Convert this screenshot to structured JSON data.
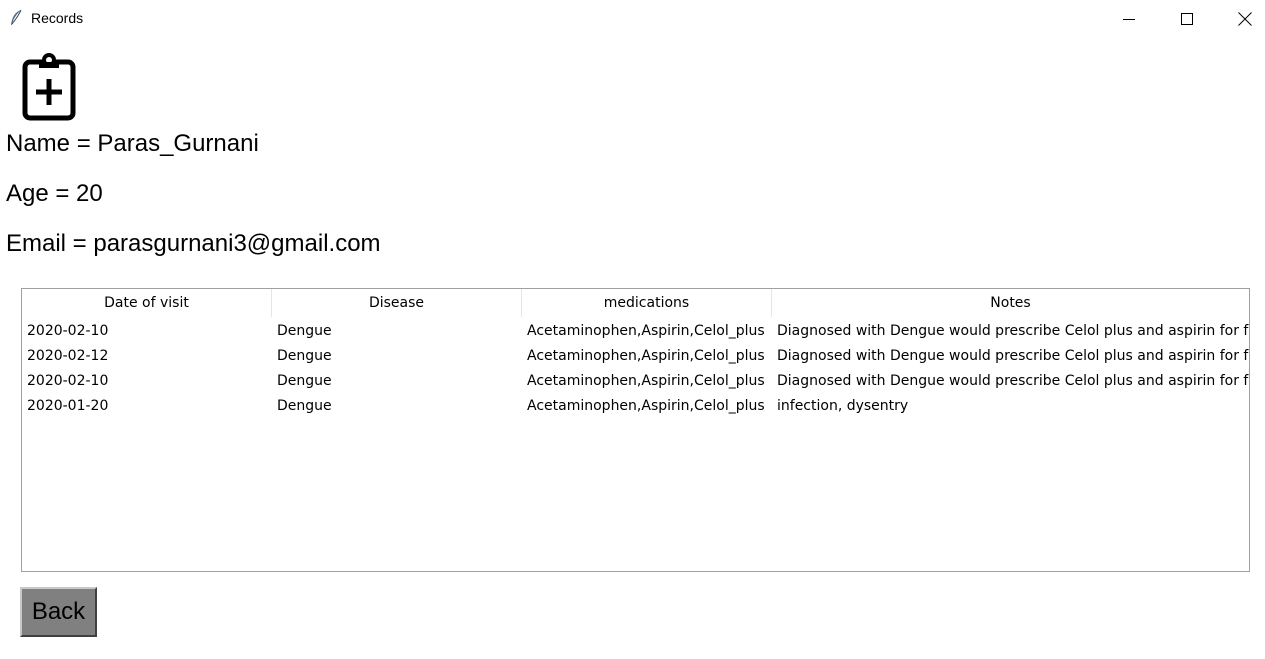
{
  "window": {
    "title": "Records",
    "icons": {
      "app": "feather-icon",
      "minimize": "minimize-icon",
      "maximize": "maximize-icon",
      "close": "close-icon"
    }
  },
  "patient": {
    "icon": "clipboard-plus-icon",
    "name_line": "Name = Paras_Gurnani",
    "age_line": "Age = 20",
    "email_line": "Email = parasgurnani3@gmail.com"
  },
  "records_table": {
    "columns": [
      "Date of visit",
      "Disease",
      "medications",
      "Notes"
    ],
    "rows": [
      [
        "2020-02-10",
        "Dengue",
        "Acetaminophen,Aspirin,Celol_plus",
        "Diagnosed with Dengue would prescribe Celol plus and aspirin for feve"
      ],
      [
        "2020-02-12",
        "Dengue",
        "Acetaminophen,Aspirin,Celol_plus",
        "Diagnosed with Dengue would prescribe Celol plus and aspirin for feve"
      ],
      [
        "2020-02-10",
        "Dengue",
        "Acetaminophen,Aspirin,Celol_plus",
        "Diagnosed with Dengue would prescribe Celol plus and aspirin for feve"
      ],
      [
        "2020-01-20",
        "Dengue",
        "Acetaminophen,Aspirin,Celol_plus",
        "infection, dysentry"
      ]
    ]
  },
  "actions": {
    "back_label": "Back",
    "back_color": "#808080"
  }
}
